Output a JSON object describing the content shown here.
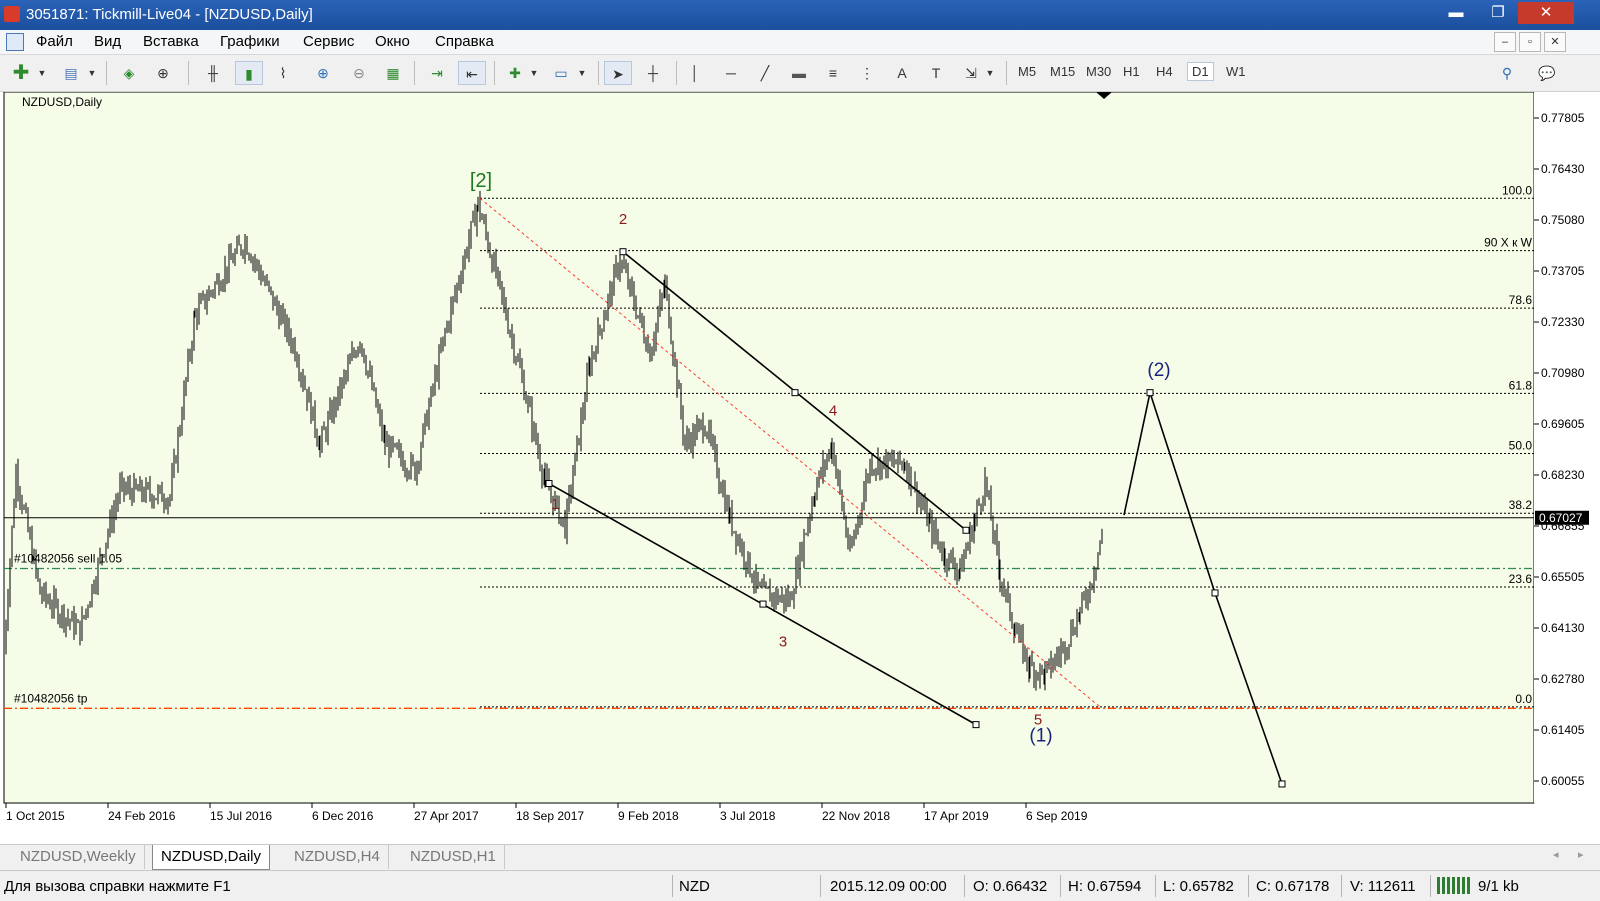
{
  "window": {
    "title": "3051871: Tickmill-Live04 - [NZDUSD,Daily]",
    "minimize": "▬",
    "restore": "❐",
    "close": "✕"
  },
  "menu": [
    "Файл",
    "Вид",
    "Вставка",
    "Графики",
    "Сервис",
    "Окно",
    "Справка"
  ],
  "timeframes": [
    "M5",
    "M15",
    "M30",
    "H1",
    "H4",
    "D1",
    "W1"
  ],
  "active_timeframe": "D1",
  "chart": {
    "symbol_label": "NZDUSD,Daily",
    "current_price": "0.67027",
    "price_ticks": [
      "0.77805",
      "0.76430",
      "0.75080",
      "0.73705",
      "0.72330",
      "0.70980",
      "0.69605",
      "0.68230",
      "0.66855",
      "0.65505",
      "0.64130",
      "0.62780",
      "0.61405",
      "0.60055"
    ],
    "date_ticks": [
      "1 Oct 2015",
      "24 Feb 2016",
      "15 Jul 2016",
      "6 Dec 2016",
      "27 Apr 2017",
      "18 Sep 2017",
      "9 Feb 2018",
      "3 Jul 2018",
      "22 Nov 2018",
      "17 Apr 2019",
      "6 Sep 2019"
    ],
    "fib_levels": [
      {
        "label": "100.0",
        "price": 0.7564
      },
      {
        "label": "90  Х к W",
        "price": 0.7423
      },
      {
        "label": "78.6",
        "price": 0.7268
      },
      {
        "label": "61.8",
        "price": 0.7038
      },
      {
        "label": "50.0",
        "price": 0.6876
      },
      {
        "label": "38.2",
        "price": 0.6715
      },
      {
        "label": "23.6",
        "price": 0.6516
      },
      {
        "label": "0.0",
        "price": 0.6193
      }
    ],
    "order_lines": [
      {
        "label": "#10482056 sell 1.05",
        "price": 0.6566
      },
      {
        "label": "#10482056 tp",
        "price": 0.6189
      }
    ],
    "wave_labels": {
      "w2_major": "[2]",
      "w1": "1",
      "w2": "2",
      "w3": "3",
      "w4": "4",
      "w5": "5",
      "w1_circle": "(1)",
      "w2_circle": "(2)"
    },
    "colors": {
      "background": "#f5fde8",
      "candles": "#000000",
      "wave_major": "#1f7a1f",
      "wave_minor": "#8b1a1a",
      "wave_circle": "#1a237e",
      "order_sell": "#2e8b57",
      "order_tp": "#ff4500",
      "diagonal": "#ff3b30"
    }
  },
  "tabs": [
    "NZDUSD,Weekly",
    "NZDUSD,Daily",
    "NZDUSD,H4",
    "NZDUSD,H1"
  ],
  "active_tab": "NZDUSD,Daily",
  "status": {
    "help": "Для вызова справки нажмите F1",
    "symbol": "NZD",
    "datetime": "2015.12.09 00:00",
    "open": "O: 0.66432",
    "high": "H: 0.67594",
    "low": "L: 0.65782",
    "close": "C: 0.67178",
    "volume": "V: 112611",
    "traffic": "9/1 kb"
  }
}
